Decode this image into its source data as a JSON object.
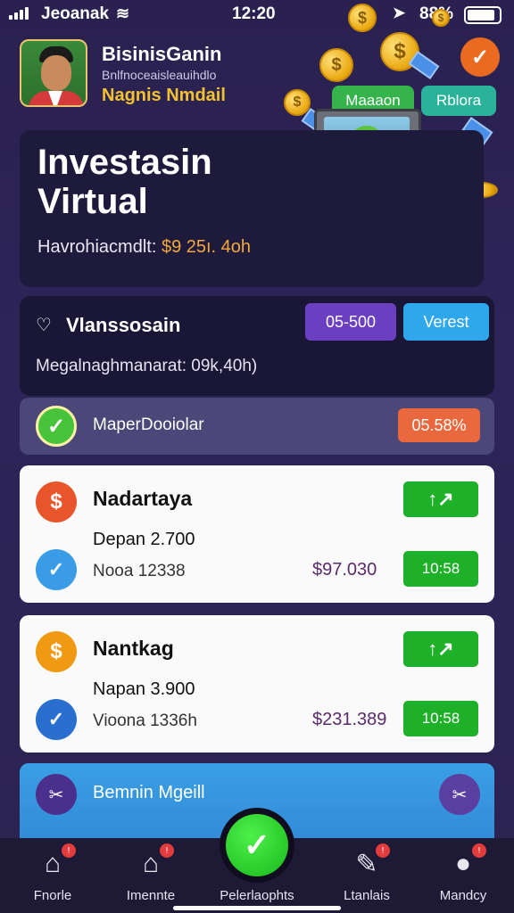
{
  "status_bar": {
    "carrier": "Jeoanak",
    "time": "12:20",
    "battery_text": "88%",
    "battery_level": 0.88
  },
  "header": {
    "name": "BisinisGanin",
    "subtitle": "Bnlfnoceaisleauihdlo",
    "role": "Nagnis Nmdail"
  },
  "hero_badges": {
    "green_pill": "Maaaon",
    "teal_pill": "Rblora"
  },
  "hero": {
    "title": "Investasin Virtual",
    "stat_label": "Havrohiacmdlt:",
    "stat_value": "$9 25ı. 4oh"
  },
  "summary": {
    "title": "Vlanssosain",
    "button_purple": "05-500",
    "button_blue": "Verest",
    "sub_label": "Megalnaghmanarat: 09k,40h)"
  },
  "status_row": {
    "label": "MaperDooiolar",
    "badge": "05.58%"
  },
  "investments": [
    {
      "name": "Nadartaya",
      "line1": "Depan 2.700",
      "line2": "Nooa 12338",
      "amount": "$97.030",
      "time": "10:58",
      "trend_icon": "↑↗",
      "dollar_color": "#e9552b",
      "check_color": "#3a9be6"
    },
    {
      "name": "Nantkag",
      "line1": "Napan 3.900",
      "line2": "Vioona 1336h",
      "amount": "$231.389",
      "time": "10:58",
      "trend_icon": "↑↗",
      "dollar_color": "#ef9a12",
      "check_color": "#2a6fd0"
    }
  ],
  "blue_card": {
    "label": "Bemnin Mgeill"
  },
  "nav": [
    {
      "label": "Fnorle",
      "icon": "home-icon"
    },
    {
      "label": "Imennte",
      "icon": "house-icon"
    },
    {
      "label": "Pelerlaophts",
      "icon": "check-icon"
    },
    {
      "label": "Ltanlais",
      "icon": "notebook-icon"
    },
    {
      "label": "Mandcy",
      "icon": "user-icon"
    }
  ]
}
